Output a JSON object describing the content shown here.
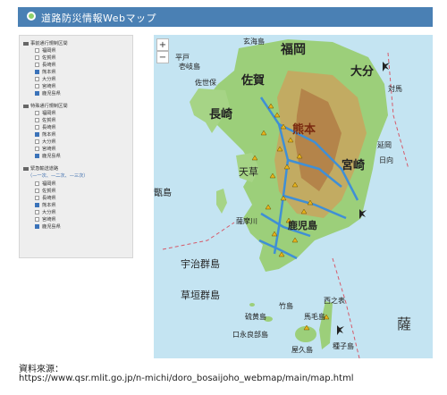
{
  "header": {
    "title": "道路防災情報Webマップ"
  },
  "panel": {
    "groups": [
      {
        "label": "事前通行規制区間",
        "items": [
          {
            "label": "福岡県",
            "checked": false
          },
          {
            "label": "佐賀県",
            "checked": false
          },
          {
            "label": "長崎県",
            "checked": false
          },
          {
            "label": "熊本県",
            "checked": true
          },
          {
            "label": "大分県",
            "checked": false
          },
          {
            "label": "宮崎県",
            "checked": false
          },
          {
            "label": "鹿児島県",
            "checked": true
          }
        ]
      },
      {
        "label": "特殊通行規制区間",
        "items": [
          {
            "label": "福岡県",
            "checked": false
          },
          {
            "label": "佐賀県",
            "checked": false
          },
          {
            "label": "長崎県",
            "checked": false
          },
          {
            "label": "熊本県",
            "checked": true
          },
          {
            "label": "大分県",
            "checked": false
          },
          {
            "label": "宮崎県",
            "checked": false
          },
          {
            "label": "鹿児島県",
            "checked": true
          }
        ]
      },
      {
        "label": "緊急輸送道路",
        "items": [
          {
            "label": "福岡県",
            "checked": false
          },
          {
            "label": "佐賀県",
            "checked": false
          },
          {
            "label": "長崎県",
            "checked": false
          },
          {
            "label": "熊本県",
            "checked": true
          },
          {
            "label": "大分県",
            "checked": false
          },
          {
            "label": "宮崎県",
            "checked": false
          },
          {
            "label": "鹿児島県",
            "checked": true
          }
        ]
      }
    ],
    "legend": "（—一次、—二次、—三次）"
  },
  "map": {
    "zoom_in": "+",
    "zoom_out": "−",
    "labels": {
      "fukuoka": "福岡",
      "saga": "佐賀",
      "oita": "大分",
      "nagasaki": "長崎",
      "kumamoto": "熊本",
      "miyazaki": "宮崎",
      "kagoshima": "鹿児島",
      "yakushima": "屋久島",
      "tanegashima": "種子島",
      "amakusa": "天草",
      "nobeoka": "延岡",
      "hyuga": "日向",
      "tsushima": "対馬",
      "koshiki": "甑島",
      "uji": "宇治群島",
      "kusagaki": "草垣群島",
      "kuchinoerabu": "口永良部島",
      "iojima": "硫黄島",
      "takeshima": "竹島",
      "satsuma": "薩摩川",
      "hirado": "平戸",
      "sasebo": "佐世保",
      "ikishima": "壱岐島",
      "genkaijima": "玄海島",
      "nishinoomote": "西之表",
      "mageshima": "馬毛島",
      "satsuma_sea": "薩"
    },
    "accent_color": "#3f8fd6"
  },
  "source": {
    "title": "資料來源：",
    "url": "https://www.qsr.mlit.go.jp/n-michi/doro_bosaijoho_webmap/main/map.html"
  }
}
